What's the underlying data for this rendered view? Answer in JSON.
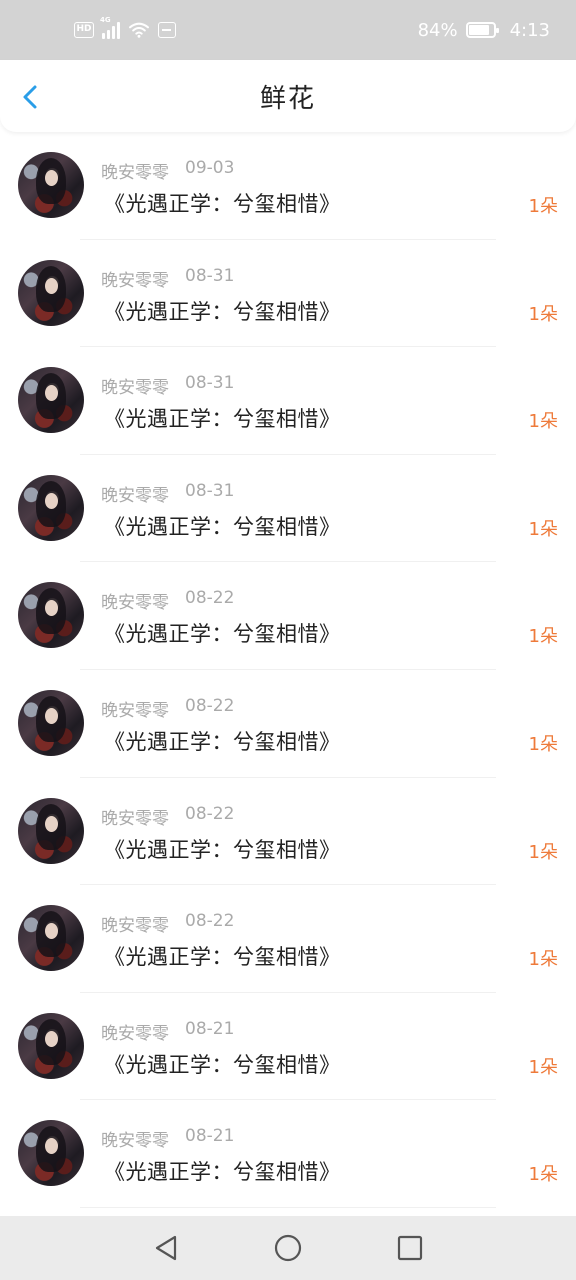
{
  "status_bar": {
    "hd": "HD",
    "network": "4G",
    "battery_percent": "84%",
    "battery_level": 0.84,
    "time": "4:13",
    "icons": [
      "hd-icon",
      "signal-icon",
      "wifi-icon",
      "message-icon",
      "battery-icon"
    ]
  },
  "header": {
    "title": "鲜花",
    "back_icon": "chevron-left-icon",
    "accent_color": "#2a9ee8"
  },
  "items": [
    {
      "user": "晚安零零",
      "date": "09-03",
      "book": "《光遇正学：兮玺相惜》",
      "count": "1朵"
    },
    {
      "user": "晚安零零",
      "date": "08-31",
      "book": "《光遇正学：兮玺相惜》",
      "count": "1朵"
    },
    {
      "user": "晚安零零",
      "date": "08-31",
      "book": "《光遇正学：兮玺相惜》",
      "count": "1朵"
    },
    {
      "user": "晚安零零",
      "date": "08-31",
      "book": "《光遇正学：兮玺相惜》",
      "count": "1朵"
    },
    {
      "user": "晚安零零",
      "date": "08-22",
      "book": "《光遇正学：兮玺相惜》",
      "count": "1朵"
    },
    {
      "user": "晚安零零",
      "date": "08-22",
      "book": "《光遇正学：兮玺相惜》",
      "count": "1朵"
    },
    {
      "user": "晚安零零",
      "date": "08-22",
      "book": "《光遇正学：兮玺相惜》",
      "count": "1朵"
    },
    {
      "user": "晚安零零",
      "date": "08-22",
      "book": "《光遇正学：兮玺相惜》",
      "count": "1朵"
    },
    {
      "user": "晚安零零",
      "date": "08-21",
      "book": "《光遇正学：兮玺相惜》",
      "count": "1朵"
    },
    {
      "user": "晚安零零",
      "date": "08-21",
      "book": "《光遇正学：兮玺相惜》",
      "count": "1朵"
    }
  ],
  "colors": {
    "status_bar_bg": "#d3d3d3",
    "count_color": "#ee7a3a",
    "meta_color": "#aaaaaa"
  },
  "nav_bar": {
    "icons": [
      "back-triangle-icon",
      "home-circle-icon",
      "recents-square-icon"
    ]
  }
}
